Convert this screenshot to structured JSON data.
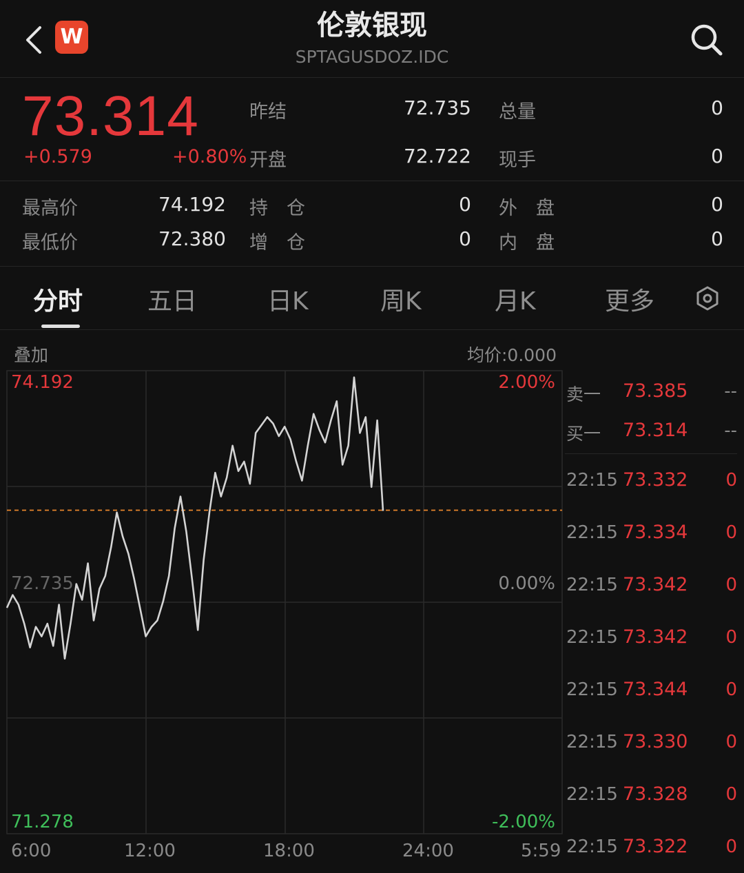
{
  "header": {
    "title": "伦敦银现",
    "subtitle": "SPTAGUSDOZ.IDC",
    "logo_letter": "W"
  },
  "quote": {
    "price": "73.314",
    "change": "+0.579",
    "change_pct": "+0.80%",
    "fields": [
      {
        "label": "昨结",
        "value": "72.735"
      },
      {
        "label": "总量",
        "value": "0"
      },
      {
        "label": "开盘",
        "value": "72.722"
      },
      {
        "label": "现手",
        "value": "0"
      },
      {
        "label": "最高价",
        "value": "74.192"
      },
      {
        "label": "持　仓",
        "value": "0"
      },
      {
        "label": "外　盘",
        "value": "0"
      },
      {
        "label": "最低价",
        "value": "72.380"
      },
      {
        "label": "增　仓",
        "value": "0"
      },
      {
        "label": "内　盘",
        "value": "0"
      }
    ]
  },
  "tabs": [
    {
      "label": "分时",
      "active": true
    },
    {
      "label": "五日",
      "active": false
    },
    {
      "label": "日K",
      "active": false
    },
    {
      "label": "周K",
      "active": false
    },
    {
      "label": "月K",
      "active": false
    },
    {
      "label": "更多",
      "active": false
    }
  ],
  "chart": {
    "overlay_label": "叠加",
    "avg_price_label": "均价:0.000",
    "y_top": "74.192",
    "y_mid": "72.735",
    "y_bottom": "71.278",
    "pct_top": "2.00%",
    "pct_mid": "0.00%",
    "pct_bottom": "-2.00%",
    "x_labels": [
      "6:00",
      "12:00",
      "18:00",
      "24:00",
      "5:59"
    ]
  },
  "order_book": [
    {
      "label": "卖一",
      "price": "73.385",
      "volume": "--"
    },
    {
      "label": "买一",
      "price": "73.314",
      "volume": "--"
    }
  ],
  "ticks": [
    {
      "time": "22:15",
      "price": "73.332",
      "volume": "0"
    },
    {
      "time": "22:15",
      "price": "73.334",
      "volume": "0"
    },
    {
      "time": "22:15",
      "price": "73.342",
      "volume": "0"
    },
    {
      "time": "22:15",
      "price": "73.342",
      "volume": "0"
    },
    {
      "time": "22:15",
      "price": "73.344",
      "volume": "0"
    },
    {
      "time": "22:15",
      "price": "73.330",
      "volume": "0"
    },
    {
      "time": "22:15",
      "price": "73.328",
      "volume": "0"
    },
    {
      "time": "22:15",
      "price": "73.322",
      "volume": "0"
    }
  ],
  "colors": {
    "up": "#e5383b",
    "down": "#3fbf5a",
    "background": "#111111",
    "line": "#d4d4d4",
    "ref_line": "#e8862c"
  },
  "chart_data": {
    "type": "line",
    "xlabel": "",
    "ylabel": "",
    "x_tick_labels": [
      "6:00",
      "12:00",
      "18:00",
      "24:00",
      "5:59"
    ],
    "ylim": [
      71.278,
      74.192
    ],
    "reference_price": 72.735,
    "last_price": 73.314,
    "series": [
      {
        "values": [
          72.7,
          72.78,
          72.72,
          72.6,
          72.45,
          72.58,
          72.52,
          72.6,
          72.46,
          72.72,
          72.38,
          72.6,
          72.85,
          72.75,
          72.98,
          72.62,
          72.82,
          72.9,
          73.08,
          73.3,
          73.15,
          73.04,
          72.88,
          72.7,
          72.52,
          72.58,
          72.62,
          72.74,
          72.9,
          73.2,
          73.4,
          73.18,
          72.88,
          72.56,
          73.0,
          73.3,
          73.55,
          73.4,
          73.52,
          73.72,
          73.56,
          73.62,
          73.48,
          73.8,
          73.85,
          73.9,
          73.86,
          73.78,
          73.84,
          73.76,
          73.62,
          73.5,
          73.72,
          73.92,
          73.82,
          73.74,
          73.88,
          74.0,
          73.6,
          73.72,
          74.15,
          73.8,
          73.9,
          73.46,
          73.88,
          73.31
        ]
      }
    ]
  }
}
